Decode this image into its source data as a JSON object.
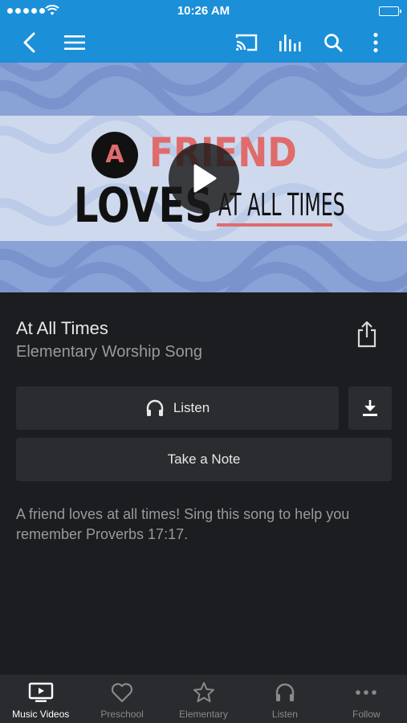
{
  "status_bar": {
    "time": "10:26 AM"
  },
  "app_bar": {
    "icons": [
      "back-icon",
      "menu-icon",
      "cast-icon",
      "equalizer-icon",
      "search-icon",
      "more-vertical-icon"
    ]
  },
  "hero": {
    "art_letter": "A",
    "art_word_1": "FRIEND",
    "art_word_2": "LOVES",
    "art_word_3": "AT ALL TIMES"
  },
  "song": {
    "title": "At All Times",
    "subtitle": "Elementary Worship Song"
  },
  "actions": {
    "listen_label": "Listen",
    "note_label": "Take a Note"
  },
  "description": "A friend loves at all times! Sing this song to help you remember Proverbs 17:17.",
  "tabs": [
    {
      "label": "Music Videos",
      "icon": "video-icon",
      "active": true
    },
    {
      "label": "Preschool",
      "icon": "heart-icon",
      "active": false
    },
    {
      "label": "Elementary",
      "icon": "star-icon",
      "active": false
    },
    {
      "label": "Listen",
      "icon": "headphones-icon",
      "active": false
    },
    {
      "label": "Follow",
      "icon": "more-horizontal-icon",
      "active": false
    }
  ],
  "colors": {
    "accent": "#1b8fd8",
    "background": "#1c1d20",
    "button": "#2b2c30",
    "tab_bar": "#2a2b2f",
    "art_red": "#e06b6b"
  }
}
